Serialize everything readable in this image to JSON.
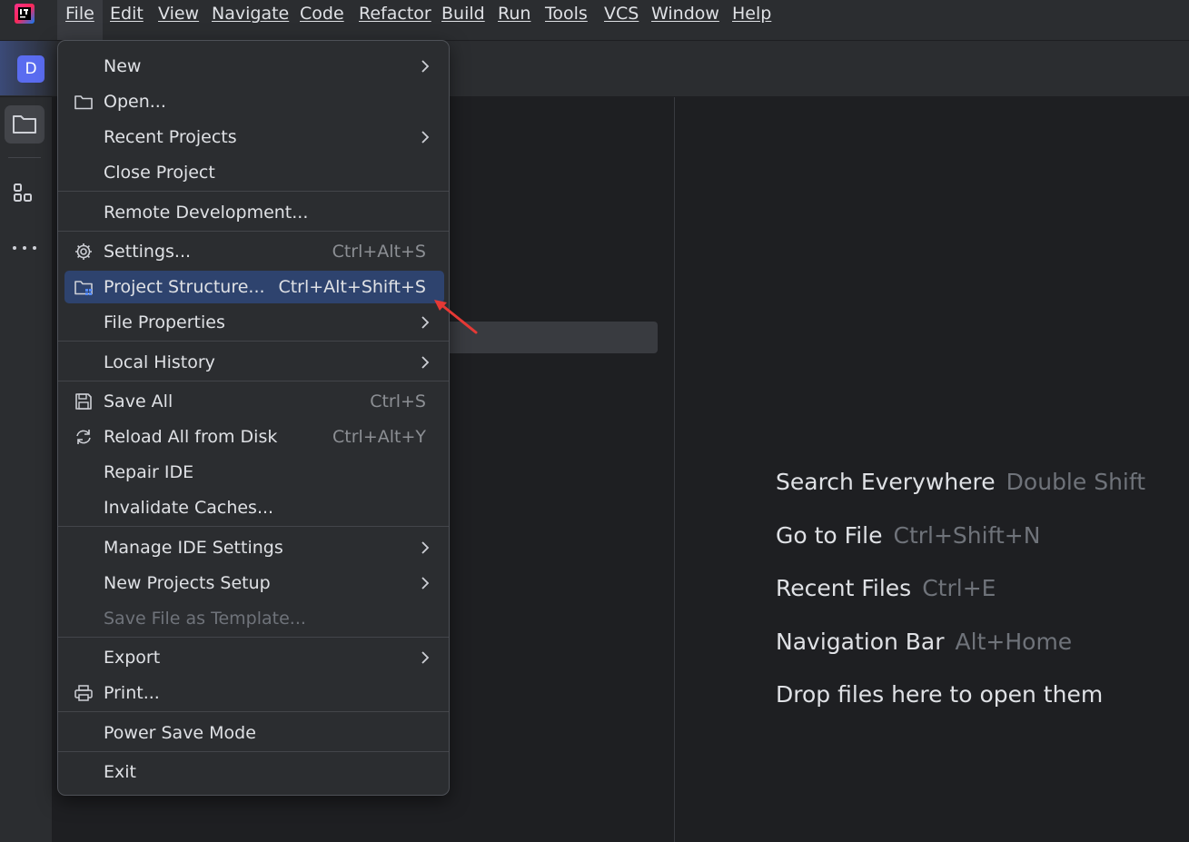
{
  "menubar": {
    "items": [
      {
        "label": "File",
        "open": true
      },
      {
        "label": "Edit"
      },
      {
        "label": "View"
      },
      {
        "label": "Navigate"
      },
      {
        "label": "Code"
      },
      {
        "label": "Refactor"
      },
      {
        "label": "Build"
      },
      {
        "label": "Run"
      },
      {
        "label": "Tools"
      },
      {
        "label": "VCS"
      },
      {
        "label": "Window"
      },
      {
        "label": "Help"
      }
    ]
  },
  "project": {
    "badge_letter": "D"
  },
  "file_menu": {
    "items": [
      {
        "label": "New",
        "submenu": true
      },
      {
        "label": "Open...",
        "icon": "folder-icon"
      },
      {
        "label": "Recent Projects",
        "submenu": true
      },
      {
        "label": "Close Project"
      },
      {
        "label": "Remote Development..."
      },
      {
        "label": "Settings...",
        "icon": "gear-icon",
        "shortcut": "Ctrl+Alt+S"
      },
      {
        "label": "Project Structure...",
        "icon": "project-structure-icon",
        "shortcut": "Ctrl+Alt+Shift+S",
        "selected": true
      },
      {
        "label": "File Properties",
        "submenu": true
      },
      {
        "label": "Local History",
        "submenu": true
      },
      {
        "label": "Save All",
        "icon": "save-icon",
        "shortcut": "Ctrl+S"
      },
      {
        "label": "Reload All from Disk",
        "icon": "reload-icon",
        "shortcut": "Ctrl+Alt+Y"
      },
      {
        "label": "Repair IDE"
      },
      {
        "label": "Invalidate Caches..."
      },
      {
        "label": "Manage IDE Settings",
        "submenu": true
      },
      {
        "label": "New Projects Setup",
        "submenu": true
      },
      {
        "label": "Save File as Template...",
        "disabled": true
      },
      {
        "label": "Export",
        "submenu": true
      },
      {
        "label": "Print...",
        "icon": "print-icon"
      },
      {
        "label": "Power Save Mode"
      },
      {
        "label": "Exit"
      }
    ]
  },
  "editor_hints": [
    {
      "label": "Search Everywhere",
      "shortcut": "Double Shift"
    },
    {
      "label": "Go to File",
      "shortcut": "Ctrl+Shift+N"
    },
    {
      "label": "Recent Files",
      "shortcut": "Ctrl+E"
    },
    {
      "label": "Navigation Bar",
      "shortcut": "Alt+Home"
    },
    {
      "label": "Drop files here to open them",
      "shortcut": ""
    }
  ],
  "colors": {
    "background": "#1e1f22",
    "panel": "#2b2d30",
    "selection": "#2e436e",
    "annotation_arrow": "#e53935"
  }
}
